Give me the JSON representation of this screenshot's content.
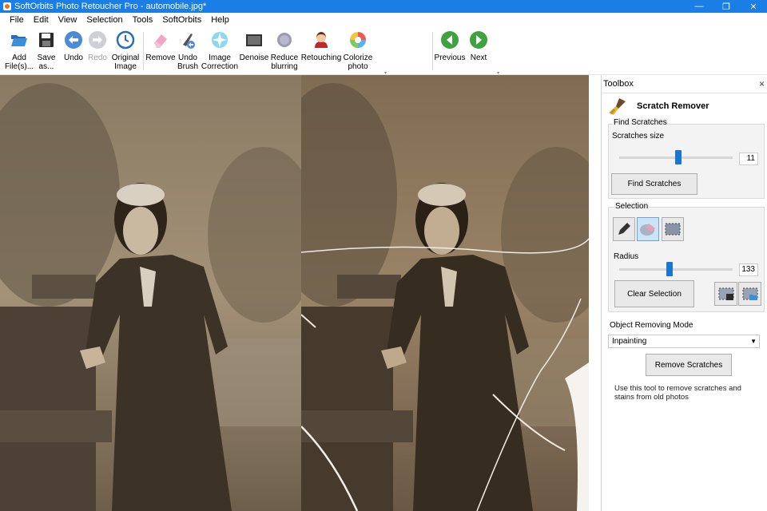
{
  "window": {
    "title": "SoftOrbits Photo Retoucher Pro - automobile.jpg*",
    "controls": {
      "minimize": "—",
      "maximize": "❐",
      "close": "✕"
    }
  },
  "menu": [
    "File",
    "Edit",
    "View",
    "Selection",
    "Tools",
    "SoftOrbits",
    "Help"
  ],
  "toolbar": {
    "add_files": "Add File(s)...",
    "save_as": "Save as...",
    "undo": "Undo",
    "redo": "Redo",
    "original_image": "Original Image",
    "remove": "Remove",
    "undo_brush": "Undo Brush",
    "image_correction": "Image Correction",
    "denoise": "Denoise",
    "reduce_blurring": "Reduce blurring",
    "retouching": "Retouching",
    "colorize_photo": "Colorize photo",
    "previous": "Previous",
    "next": "Next"
  },
  "toolbox": {
    "header": "Toolbox",
    "close": "×",
    "tool_title": "Scratch Remover",
    "find_group": {
      "label": "Find Scratches",
      "size_label": "Scratches size",
      "size_value": "11",
      "size_fraction": 0.52,
      "button": "Find Scratches"
    },
    "selection_group": {
      "label": "Selection",
      "radius_label": "Radius",
      "radius_value": "133",
      "radius_fraction": 0.44,
      "clear_button": "Clear Selection"
    },
    "mode_label": "Object Removing Mode",
    "mode_value": "Inpainting",
    "remove_button": "Remove Scratches",
    "hint": "Use this tool to remove scratches and stains from old photos"
  },
  "colors": {
    "titlebar": "#1a7ee6",
    "accent": "#1976d2"
  }
}
